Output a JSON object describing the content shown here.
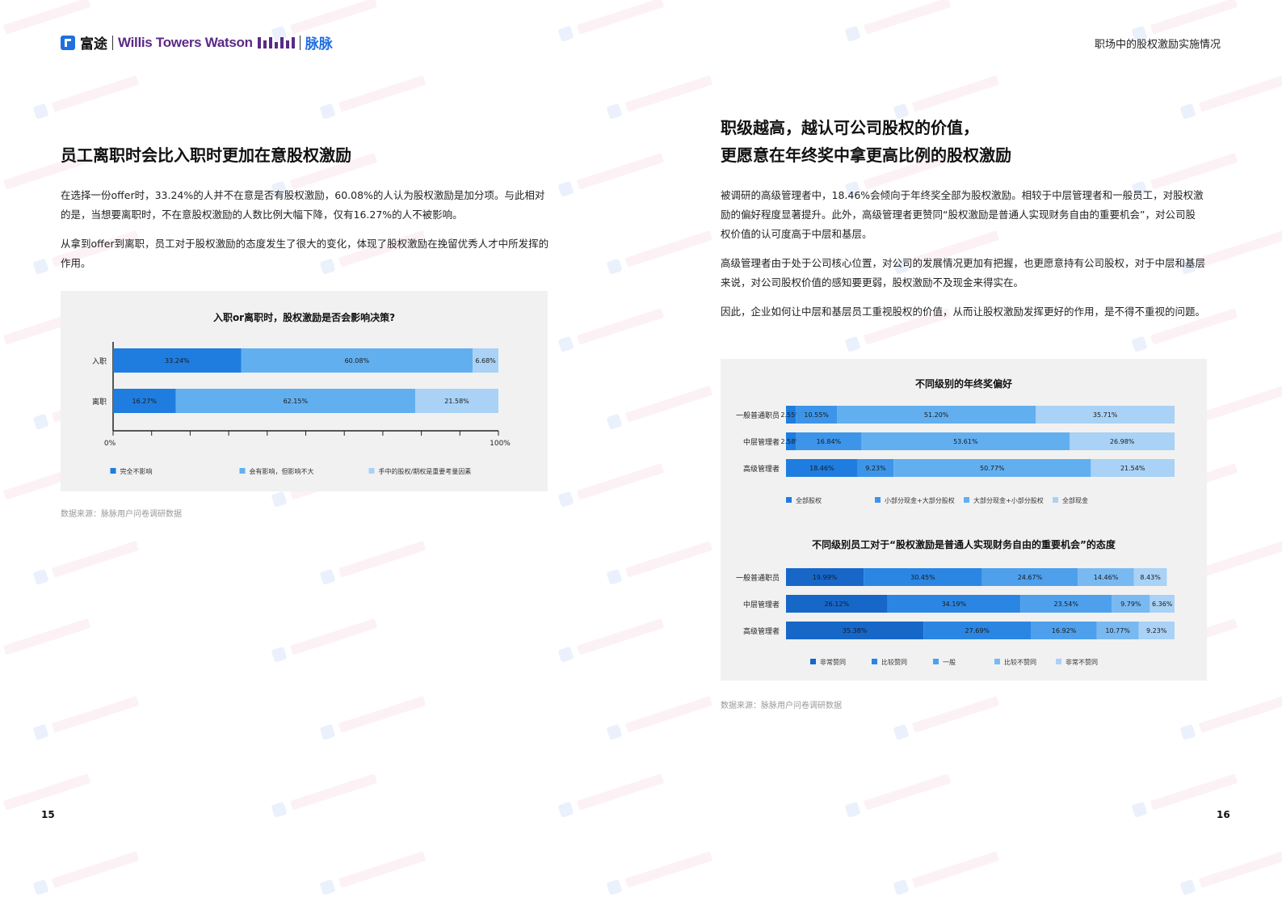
{
  "header": {
    "logo_fu": "富途",
    "logo_wtw": "Willis Towers Watson",
    "logo_maimai": "脉脉",
    "section_title": "职场中的股权激励实施情况"
  },
  "left": {
    "heading": "员工离职时会比入职时更加在意股权激励",
    "para1": "在选择一份offer时，33.24%的人并不在意是否有股权激励，60.08%的人认为股权激励是加分项。与此相对的是，当想要离职时，不在意股权激励的人数比例大幅下降，仅有16.27%的人不被影响。",
    "para2": "从拿到offer到离职，员工对于股权激励的态度发生了很大的变化，体现了股权激励在挽留优秀人才中所发挥的作用。",
    "source": "数据来源：脉脉用户问卷调研数据",
    "page_number": "15"
  },
  "right": {
    "heading_line1": "职级越高，越认可公司股权的价值，",
    "heading_line2": "更愿意在年终奖中拿更高比例的股权激励",
    "para1": "被调研的高级管理者中，18.46%会倾向于年终奖全部为股权激励。相较于中层管理者和一般员工，对股权激励的偏好程度显著提升。此外，高级管理者更赞同“股权激励是普通人实现财务自由的重要机会”，对公司股权价值的认可度高于中层和基层。",
    "para2": "高级管理者由于处于公司核心位置，对公司的发展情况更加有把握，也更愿意持有公司股权，对于中层和基层来说，对公司股权价值的感知要更弱，股权激励不及现金来得实在。",
    "para3": "因此，企业如何让中层和基层员工重视股权的价值，从而让股权激励发挥更好的作用，是不得不重视的问题。",
    "source": "数据来源：脉脉用户问卷调研数据",
    "page_number": "16"
  },
  "chart_data": [
    {
      "type": "bar",
      "orientation": "horizontal",
      "stacked": true,
      "title": "入职or离职时，股权激励是否会影响决策?",
      "categories": [
        "入职",
        "离职"
      ],
      "series": [
        {
          "name": "完全不影响",
          "values": [
            33.24,
            16.27
          ],
          "labels": [
            "33.24%",
            "16.27%"
          ],
          "color": "#1f7de0"
        },
        {
          "name": "会有影响，但影响不大",
          "values": [
            60.08,
            62.15
          ],
          "labels": [
            "60.08%",
            "62.15%"
          ],
          "color": "#62aff0"
        },
        {
          "name": "手中的股权/期权是重要考量因素",
          "values": [
            6.68,
            21.58
          ],
          "labels": [
            "6.68%",
            "21.58%"
          ],
          "color": "#a9d2f6"
        }
      ],
      "xlim": [
        0,
        100
      ],
      "tick_labels": [
        "0%",
        "100%"
      ]
    },
    {
      "type": "bar",
      "orientation": "horizontal",
      "stacked": true,
      "title": "不同级别的年终奖偏好",
      "categories": [
        "一般普通职员",
        "中层管理者",
        "高级管理者"
      ],
      "series": [
        {
          "name": "全部股权",
          "values": [
            2.55,
            2.58,
            18.46
          ],
          "labels": [
            "2.55%",
            "2.58%",
            "18.46%"
          ],
          "color": "#1f7de0"
        },
        {
          "name": "小部分现金+大部分股权",
          "values": [
            10.55,
            16.84,
            9.23
          ],
          "labels": [
            "10.55%",
            "16.84%",
            "9.23%"
          ],
          "color": "#3d95ea"
        },
        {
          "name": "大部分现金+小部分股权",
          "values": [
            51.2,
            53.61,
            50.77
          ],
          "labels": [
            "51.20%",
            "53.61%",
            "50.77%"
          ],
          "color": "#62aff0"
        },
        {
          "name": "全部现金",
          "values": [
            35.71,
            26.98,
            21.54
          ],
          "labels": [
            "35.71%",
            "26.98%",
            "21.54%"
          ],
          "color": "#a9d2f6"
        }
      ]
    },
    {
      "type": "bar",
      "orientation": "horizontal",
      "stacked": true,
      "title": "不同级别员工对于“股权激励是普通人实现财务自由的重要机会”的态度",
      "categories": [
        "一般普通职员",
        "中层管理者",
        "高级管理者"
      ],
      "series": [
        {
          "name": "非常赞同",
          "values": [
            19.99,
            26.12,
            35.38
          ],
          "labels": [
            "19.99%",
            "26.12%",
            "35.38%"
          ],
          "color": "#1767c9"
        },
        {
          "name": "比较赞同",
          "values": [
            30.45,
            34.19,
            27.69
          ],
          "labels": [
            "30.45%",
            "34.19%",
            "27.69%"
          ],
          "color": "#2b86e3"
        },
        {
          "name": "一般",
          "values": [
            24.67,
            23.54,
            16.92
          ],
          "labels": [
            "24.67%",
            "23.54%",
            "16.92%"
          ],
          "color": "#4ea0ec"
        },
        {
          "name": "比较不赞同",
          "values": [
            14.46,
            9.79,
            10.77
          ],
          "labels": [
            "14.46%",
            "9.79%",
            "10.77%"
          ],
          "color": "#79b9f2"
        },
        {
          "name": "非常不赞同",
          "values": [
            8.43,
            6.36,
            9.23
          ],
          "labels": [
            "8.43%",
            "6.36%",
            "9.23%"
          ],
          "color": "#a9d2f6"
        }
      ]
    }
  ]
}
